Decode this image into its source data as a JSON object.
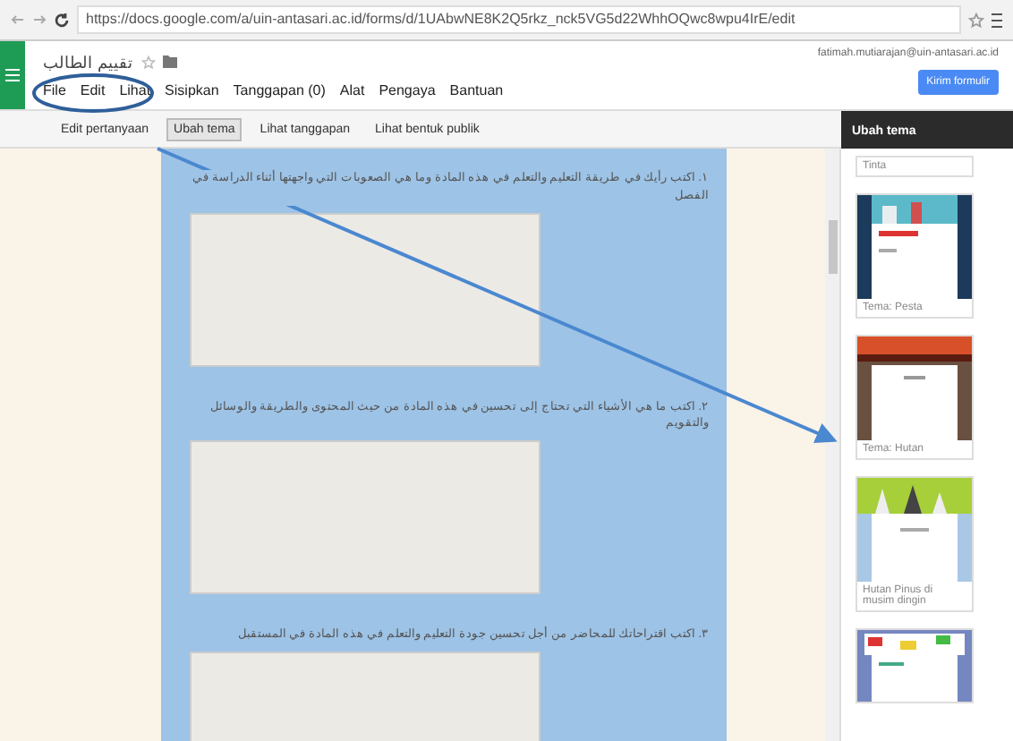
{
  "browser": {
    "url": "https://docs.google.com/a/uin-antasari.ac.id/forms/d/1UAbwNE8K2Q5rkz_nck5VG5d22WhhOQwc8wpu4IrE/edit"
  },
  "doc": {
    "title": "تقييم الطالب",
    "account": "fatimah.mutiarajan@uin-antasari.ac.id"
  },
  "menu": [
    {
      "label": "File"
    },
    {
      "label": "Edit"
    },
    {
      "label": "Lihat"
    },
    {
      "label": "Sisipkan"
    },
    {
      "label": "Tanggapan (0)"
    },
    {
      "label": "Alat"
    },
    {
      "label": "Pengaya"
    },
    {
      "label": "Bantuan"
    }
  ],
  "send_button": "Kirim formulir",
  "toolbar": [
    {
      "label": "Edit pertanyaan",
      "selected": false
    },
    {
      "label": "Ubah tema",
      "selected": true
    },
    {
      "label": "Lihat tanggapan",
      "selected": false
    },
    {
      "label": "Lihat bentuk publik",
      "selected": false
    }
  ],
  "questions": [
    {
      "text": "١. اكتب رأيك في طريقة التعليم والتعلم في هذه المادة وما هي الصعوبات التي واجهتها أثناء الدراسة في الفصل"
    },
    {
      "text": "٢. اكتب ما هي الأشياء التي تحتاج إلى تحسين في هذه المادة من حيث المحتوى والطريقة والوسائل والتقويم"
    },
    {
      "text": "٣. اكتب اقتراحاتك للمحاضر من أجل تحسين جودة التعليم والتعلم في هذه المادة في المستقبل"
    }
  ],
  "theme_panel": {
    "title": "Ubah tema",
    "themes": [
      {
        "name": "Tinta",
        "kind": "plain"
      },
      {
        "name": "Tema: Pesta",
        "kind": "city"
      },
      {
        "name": "Tema: Hutan",
        "kind": "sunset"
      },
      {
        "name": "Hutan Pinus di musim dingin",
        "kind": "forest"
      },
      {
        "kind": "cars"
      }
    ]
  }
}
